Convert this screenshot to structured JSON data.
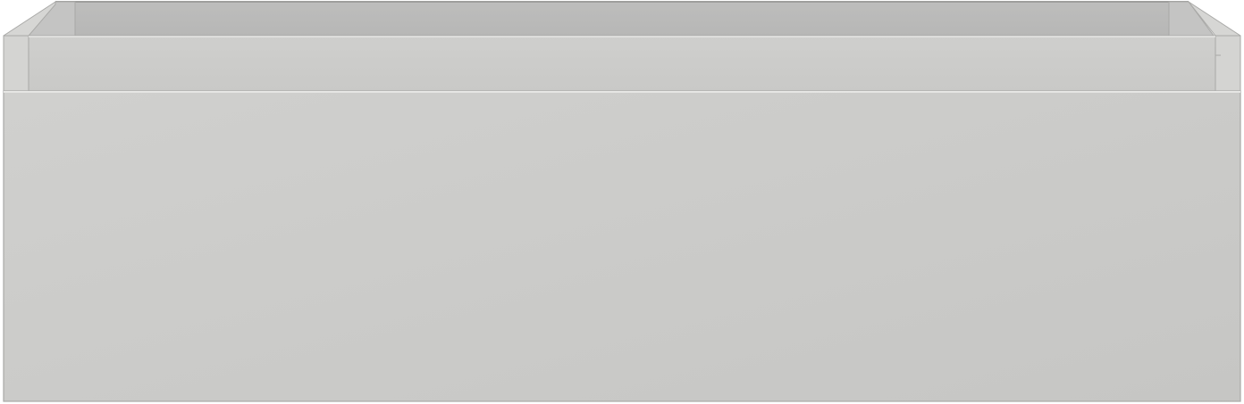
{
  "object": {
    "kind": "drawer-unit",
    "colors": {
      "front_light": "#cfcfcd",
      "front_dark": "#c6c6c4",
      "inner_back": "#b9b9b8",
      "inner_back_top": "#c2c2c1",
      "side_wall": "#d4d4d2",
      "inner_side": "#c9c9c8",
      "rim": "#e6e6e4",
      "edge": "#a9a9a7",
      "background": "#ffffff"
    }
  }
}
